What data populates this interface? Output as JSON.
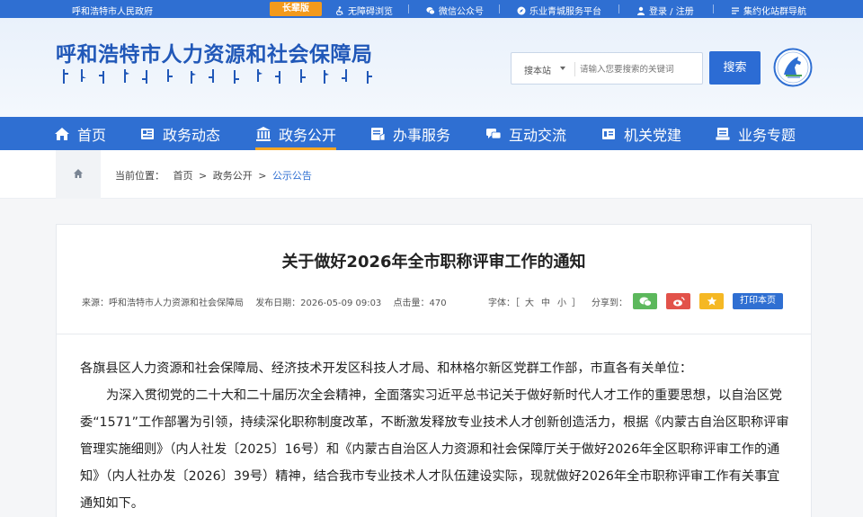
{
  "topbar": {
    "org_name": "呼和浩特市人民政府",
    "elder_mode": "长辈版",
    "accessibility": "无障碍浏览",
    "wechat": "微信公众号",
    "platform": "乐业青城服务平台",
    "login": "登录 / 注册",
    "site_nav": "集约化站群导航"
  },
  "header": {
    "title": "呼和浩特市人力资源和社会保障局",
    "search_scope": "搜本站",
    "search_placeholder": "请输入您要搜索的关键词",
    "search_button": "搜索"
  },
  "nav": {
    "items": [
      {
        "label": "首页",
        "icon": "home-icon"
      },
      {
        "label": "政务动态",
        "icon": "news-icon"
      },
      {
        "label": "政务公开",
        "icon": "building-icon"
      },
      {
        "label": "办事服务",
        "icon": "service-icon"
      },
      {
        "label": "互动交流",
        "icon": "chat-icon"
      },
      {
        "label": "机关党建",
        "icon": "party-icon"
      },
      {
        "label": "业务专题",
        "icon": "topic-icon"
      }
    ],
    "active_index": 2
  },
  "breadcrumb": {
    "prefix": "当前位置：",
    "items": [
      "首页",
      "政务公开",
      "公示公告"
    ],
    "separator": ">"
  },
  "article": {
    "title": "关于做好2026年全市职称评审工作的通知",
    "source": "来源：呼和浩特市人力资源和社会保障局",
    "date": "发布日期：2026-05-09 09:03",
    "views": "点击量：470",
    "font_label": "字体：［",
    "font_large": "大",
    "font_medium": "中",
    "font_small": "小",
    "font_close": "］",
    "share_label": "分享到：",
    "print": "打印本页",
    "salutation": "各旗县区人力资源和社会保障局、经济技术开发区科技人才局、和林格尔新区党群工作部，市直各有关单位：",
    "paragraph1": "为深入贯彻党的二十大和二十届历次全会精神，全面落实习近平总书记关于做好新时代人才工作的重要思想，以自治区党委“1571”工作部署为引领，持续深化职称制度改革，不断激发释放专业技术人才创新创造活力，根据《内蒙古自治区职称评审管理实施细则》（内人社发〔2025〕16号）和《内蒙古自治区人力资源和社会保障厅关于做好2026年全区职称评审工作的通知》（内人社办发〔2026〕39号）精神，结合我市专业技术人才队伍建设实际，现就做好2026年全市职称评审工作有关事宜通知如下。"
  },
  "colors": {
    "primary": "#2f6fd2",
    "accent": "#f39a1c",
    "wechat": "#5cb85c",
    "weibo": "#e2524a",
    "favorite": "#f5b824"
  }
}
